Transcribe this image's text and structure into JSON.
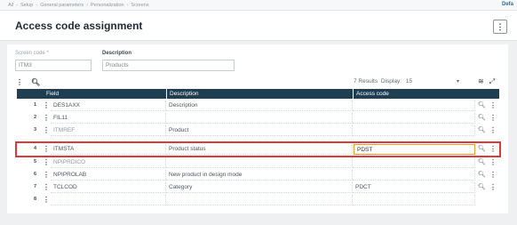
{
  "breadcrumb": {
    "items": [
      "All",
      "Setup",
      "General parameters",
      "Personalization",
      "Screens"
    ],
    "right_label": "Defa"
  },
  "header": {
    "title": "Access code assignment",
    "menu_icon": "kebab-vertical-icon"
  },
  "form": {
    "screen_code_label": "Screen code",
    "screen_code_value": "ITM3",
    "description_label": "Description",
    "description_value": "Products"
  },
  "grid": {
    "results_text": "7 Results",
    "display_label": "Display:",
    "page_size": "15",
    "columns": [
      "Field",
      "Description",
      "Access code"
    ],
    "rows": [
      {
        "num": "1",
        "field": "DES1AXX",
        "description": "Description",
        "access_code": ""
      },
      {
        "num": "2",
        "field": "FIL11",
        "description": "",
        "access_code": ""
      },
      {
        "num": "3",
        "field": "ITMREF",
        "description": "Product",
        "access_code": ""
      },
      {
        "num": "4",
        "field": "ITMSTA",
        "description": "Product status",
        "access_code": "PDST"
      },
      {
        "num": "5",
        "field": "NPIPRDICO",
        "description": "",
        "access_code": ""
      },
      {
        "num": "6",
        "field": "NPIPROLAB",
        "description": "New product in design mode",
        "access_code": ""
      },
      {
        "num": "7",
        "field": "TCLCOD",
        "description": "Category",
        "access_code": "PDCT"
      },
      {
        "num": "8",
        "field": "",
        "description": "",
        "access_code": ""
      }
    ],
    "selected_row": 4
  }
}
